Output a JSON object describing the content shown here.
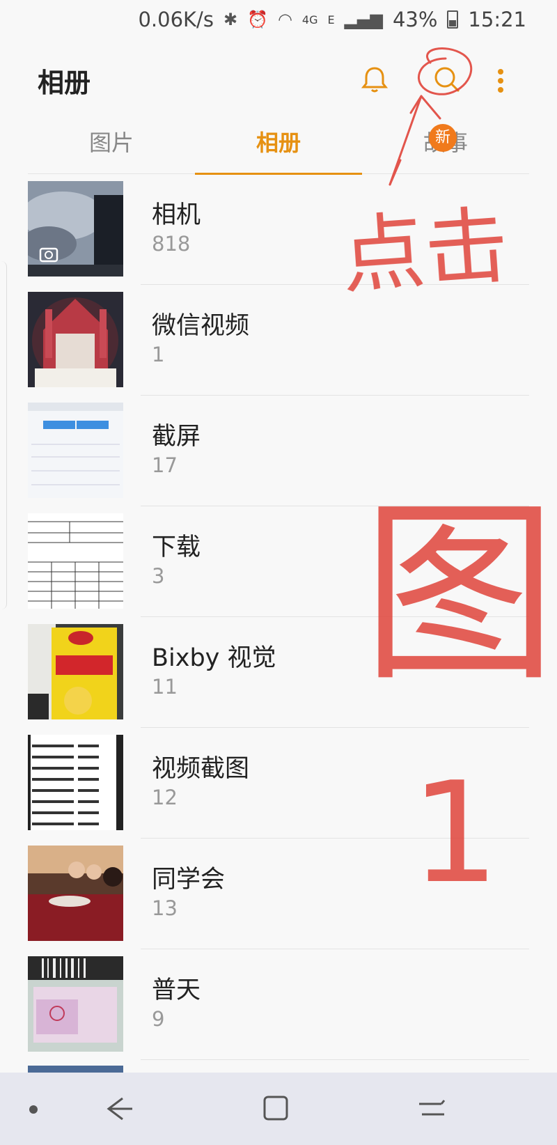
{
  "status_bar": {
    "speed": "0.06K/s",
    "network1": "4G",
    "network2": "E",
    "battery": "43%",
    "time": "15:21"
  },
  "header": {
    "title": "相册"
  },
  "actions": {
    "bell": "bell-icon",
    "search": "search-icon",
    "more": "more-vert-icon"
  },
  "tabs": [
    {
      "label": "图片"
    },
    {
      "label": "相册"
    },
    {
      "label": "故事"
    }
  ],
  "badge": "新",
  "albums": [
    {
      "name": "相机",
      "count": "818"
    },
    {
      "name": "微信视频",
      "count": "1"
    },
    {
      "name": "截屏",
      "count": "17"
    },
    {
      "name": "下载",
      "count": "3"
    },
    {
      "name": "Bixby 视觉",
      "count": "11"
    },
    {
      "name": "视频截图",
      "count": "12"
    },
    {
      "name": "同学会",
      "count": "13"
    },
    {
      "name": "普天",
      "count": "9"
    }
  ],
  "annotation": {
    "text1": "点击",
    "text2": "图",
    "text3": "1"
  },
  "colors": {
    "accent": "#e69112",
    "badge": "#f07a1c",
    "ink": "#e0443a"
  }
}
